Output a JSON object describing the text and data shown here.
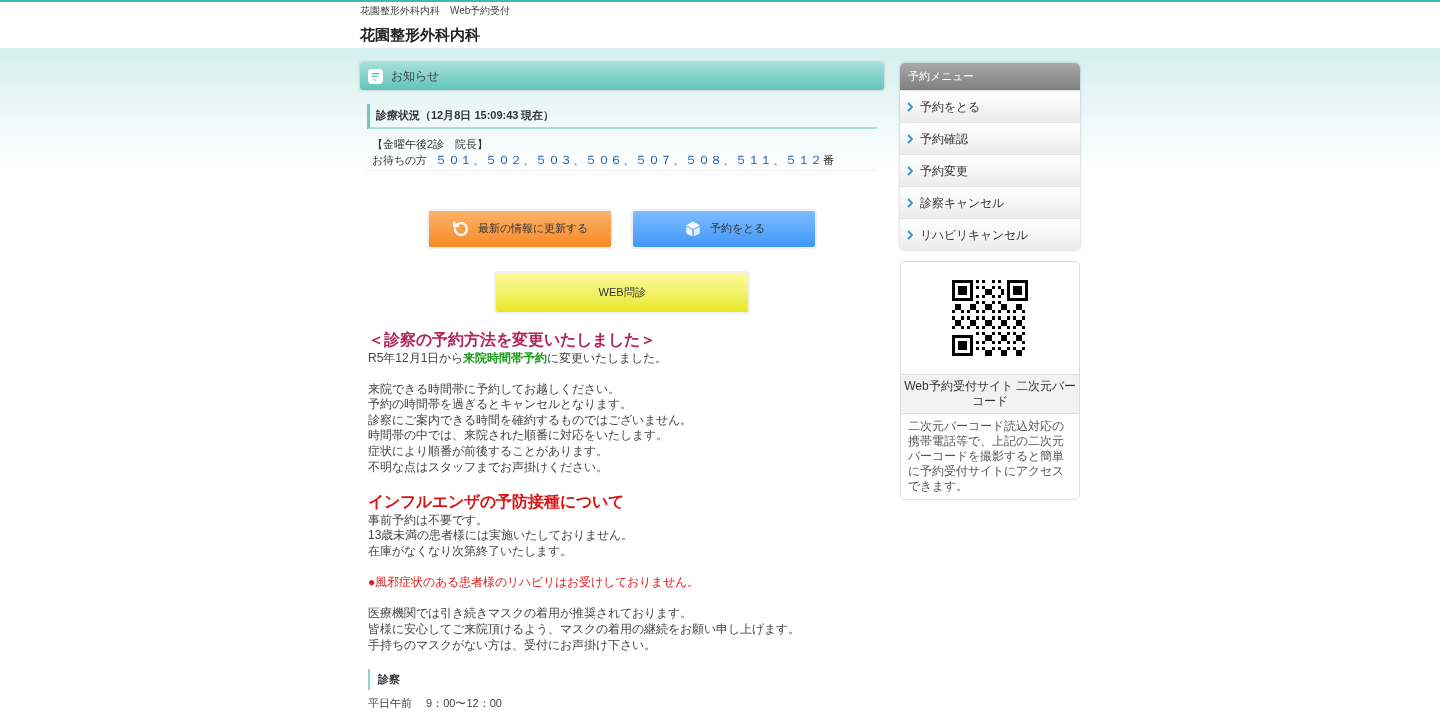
{
  "header": {
    "breadcrumb": "花園整形外科内科　Web予約受付",
    "title": "花園整形外科内科"
  },
  "notice_panel": {
    "title": "お知らせ"
  },
  "status": {
    "heading": "診療状況（12月8日 15:09:43 現在）",
    "session": "【金曜午後2診　院長】",
    "waiting_label": "お待ちの方",
    "waiting_numbers": "５０１、５０２、５０３、５０６、５０７、５０８、５１１、５１２",
    "waiting_suffix": "番"
  },
  "buttons": [
    {
      "kind": "refresh",
      "label": "最新の情報に更新する"
    },
    {
      "kind": "reserve",
      "label": "予約をとる"
    }
  ],
  "web_button": {
    "label": "WEB問診"
  },
  "notices": [
    {
      "kind": "heading",
      "color": "#b3245c",
      "text": "＜診察の予約方法を変更いたしました＞"
    },
    {
      "kind": "paragraph",
      "lines": [
        "R5年12月1日から**来院時間帯予約**に変更いたしました。"
      ]
    },
    {
      "kind": "paragraph",
      "lines": [
        "来院できる時間帯に予約してお越しください。",
        "予約の時間帯を過ぎるとキャンセルとなります。",
        "診察にご案内できる時間を確約するものではございません。",
        "時間帯の中では、来院された順番に対応をいたします。",
        "症状により順番が前後することがあります。",
        "不明な点はスタッフまでお声掛けください。"
      ]
    },
    {
      "kind": "heading",
      "color": "#dd1111",
      "text": "インフルエンザの予防接種について"
    },
    {
      "kind": "paragraph",
      "lines": [
        "事前予約は不要です。",
        "13歳未満の患者様には実施いたしておりません。",
        "在庫がなくなり次第終了いたします。"
      ]
    },
    {
      "kind": "alert",
      "lines": [
        "●風邪症状のある患者様のリハビリはお受けしておりません。"
      ]
    },
    {
      "kind": "paragraph",
      "lines": [
        "医療機関では引き続きマスクの着用が推奨されております。",
        "皆様に安心してご来院頂けるよう、マスクの着用の継続をお願い申し上げます。",
        "手持ちのマスクがない方は、受付にお声掛け下さい。"
      ]
    }
  ],
  "hours": {
    "heading": "診察",
    "lines": [
      "平日午前　 9：00〜12：00"
    ]
  },
  "sidebar": {
    "menu_title": "予約メニュー",
    "items": [
      "予約をとる",
      "予約確認",
      "予約変更",
      "診察キャンセル",
      "リハビリキャンセル"
    ],
    "qr": {
      "caption": "Web予約受付サイト 二次元バーコード",
      "description": "二次元バーコード読込対応の携帯電話等で、上記の二次元バーコードを撮影すると簡単に予約受付サイトにアクセスできます。"
    }
  }
}
